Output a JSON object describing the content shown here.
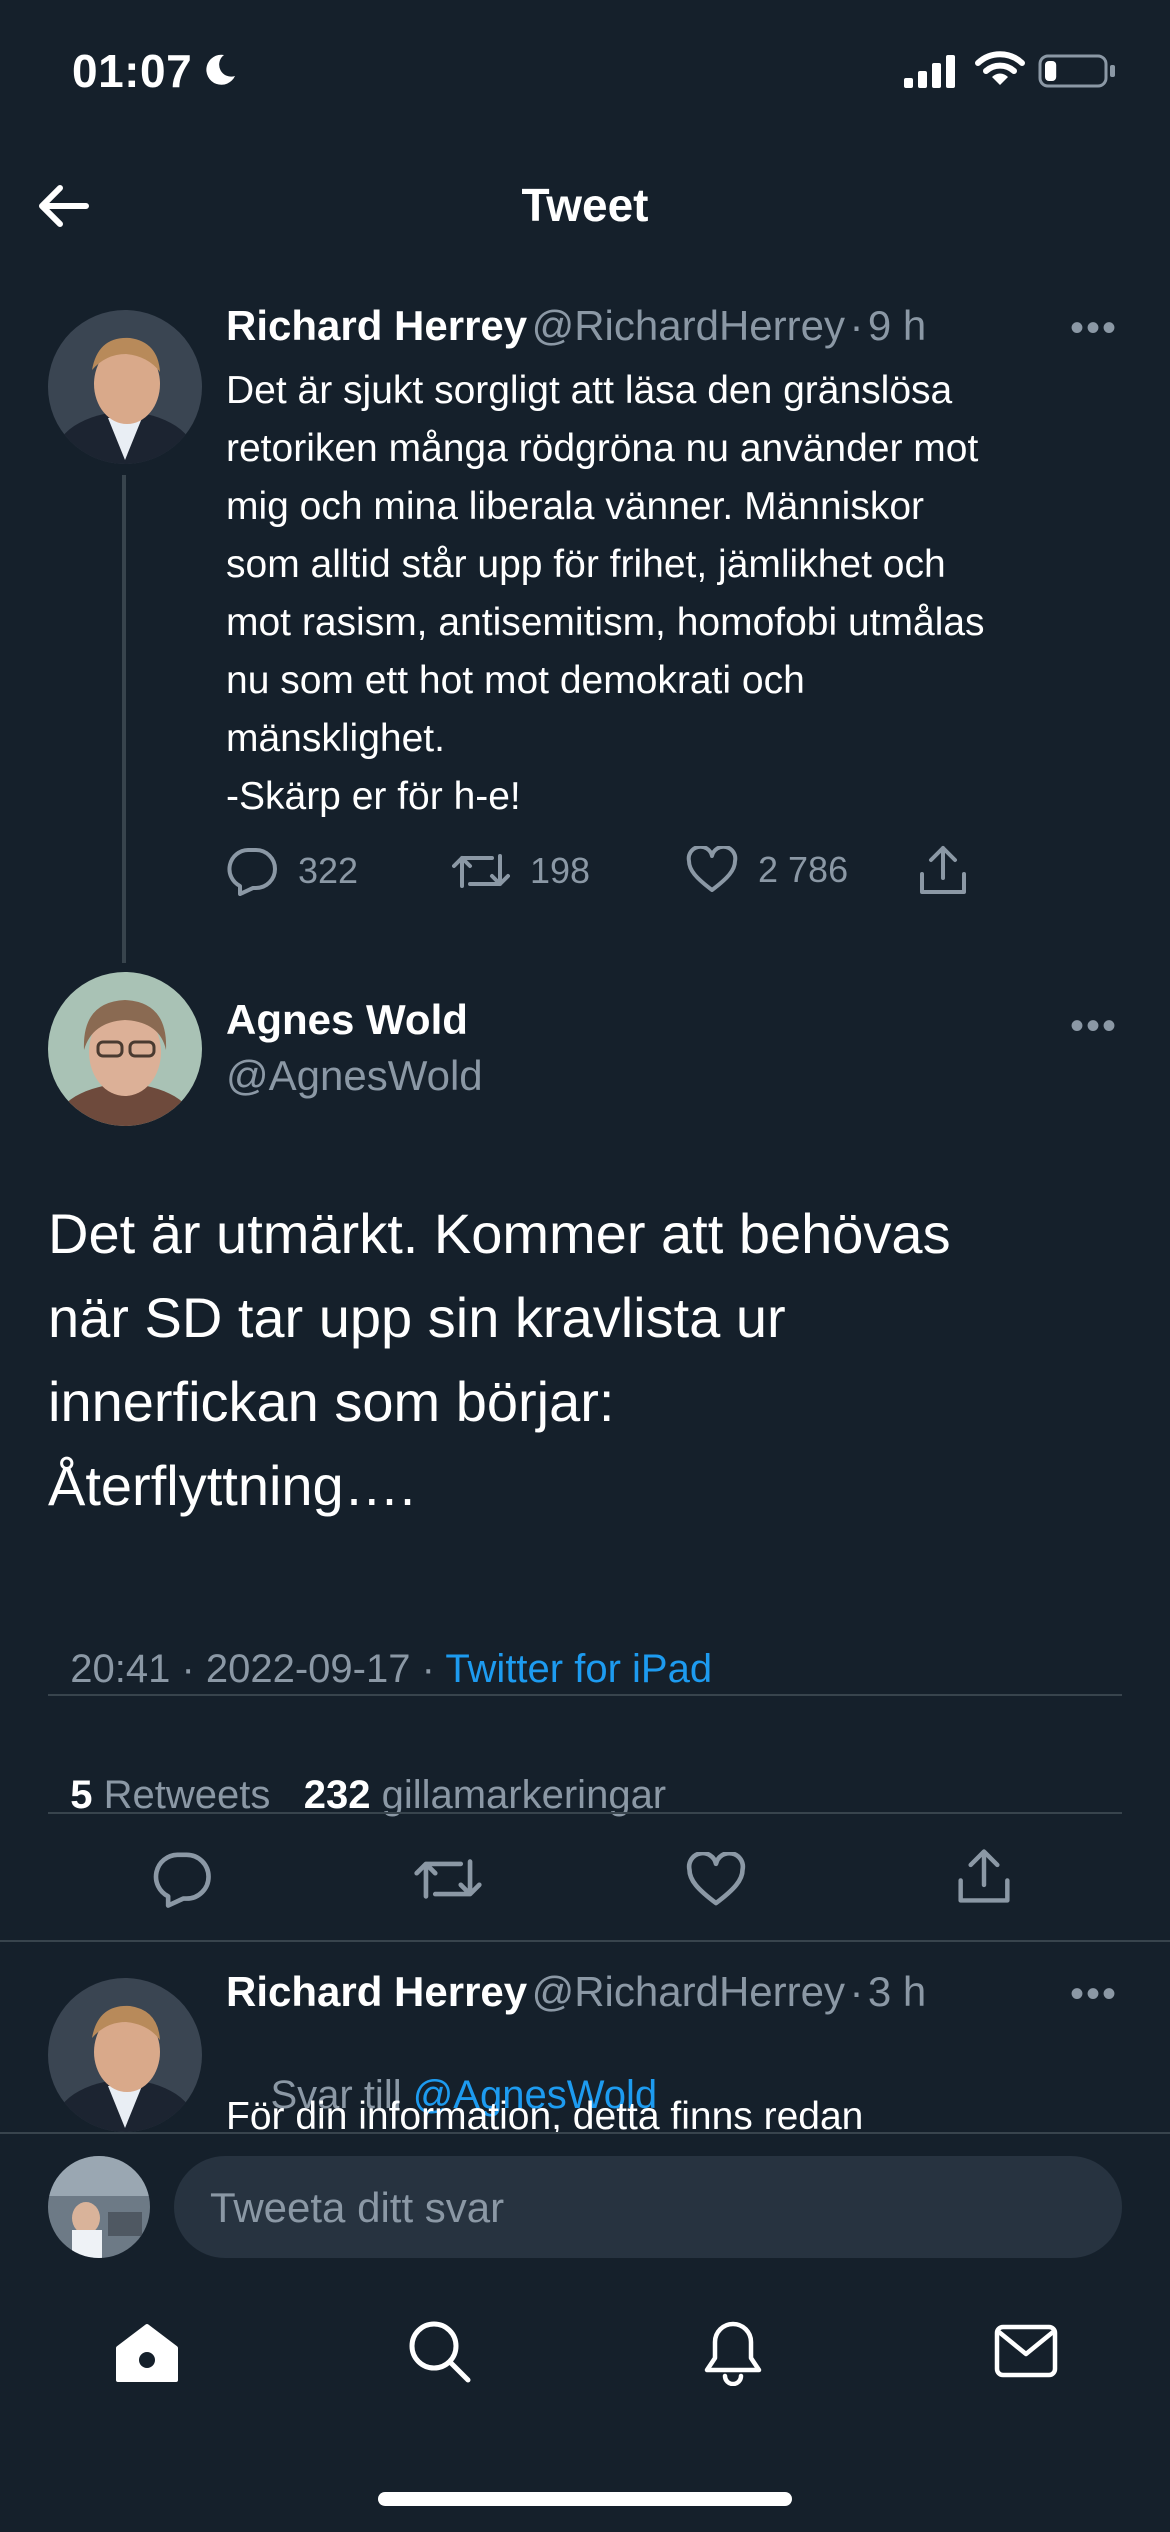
{
  "status_bar": {
    "time": "01:07",
    "battery_level": 0.2
  },
  "header": {
    "title": "Tweet"
  },
  "parent_tweet": {
    "author_name": "Richard Herrey",
    "author_handle": "@RichardHerrey",
    "separator": "·",
    "time_ago": "9 h",
    "lines": [
      "Det är sjukt sorgligt att läsa den gränslösa",
      "retoriken många rödgröna nu använder mot",
      "mig och mina liberala vänner. Människor",
      "som alltid står upp för frihet, jämlikhet och",
      "mot rasism, antisemitism, homofobi utmålas",
      "nu som ett hot mot demokrati och",
      "mänsklighet.",
      "-Skärp er för h-e!"
    ],
    "reply_count": "322",
    "retweet_count": "198",
    "like_count": "2 786"
  },
  "main_tweet": {
    "author_name": "Agnes Wold",
    "author_handle": "@AgnesWold",
    "lines": [
      "Det är utmärkt. Kommer att behövas",
      "när SD tar upp sin kravlista ur",
      "innerfickan som börjar:",
      "Återflyttning…."
    ],
    "timestamp": "20:41 · 2022-09-17 · ",
    "source": "Twitter for iPad",
    "retweets_count": "5",
    "retweets_label": "Retweets",
    "likes_count": "232",
    "likes_label": "gillamarkeringar"
  },
  "reply_tweet": {
    "author_name": "Richard Herrey",
    "author_handle": "@RichardHerrey",
    "separator": "·",
    "time_ago": "3 h",
    "reply_to_prefix": "Svar till ",
    "reply_to_handle": "@AgnesWold",
    "preview_line": "För din information, detta finns redan"
  },
  "composer": {
    "placeholder": "Tweeta ditt svar"
  },
  "more_glyph": "•••",
  "icons": {
    "back": "arrow-left-icon",
    "reply": "comment-icon",
    "retweet": "retweet-icon",
    "like": "heart-icon",
    "share": "share-icon",
    "more": "more-icon",
    "home": "home-icon",
    "search": "search-icon",
    "notifications": "bell-icon",
    "messages": "mail-icon"
  },
  "colors": {
    "background": "#15202b",
    "text": "#ffffff",
    "muted": "#8b98a5",
    "accent": "#1d9bf0",
    "divider": "#38444d"
  }
}
